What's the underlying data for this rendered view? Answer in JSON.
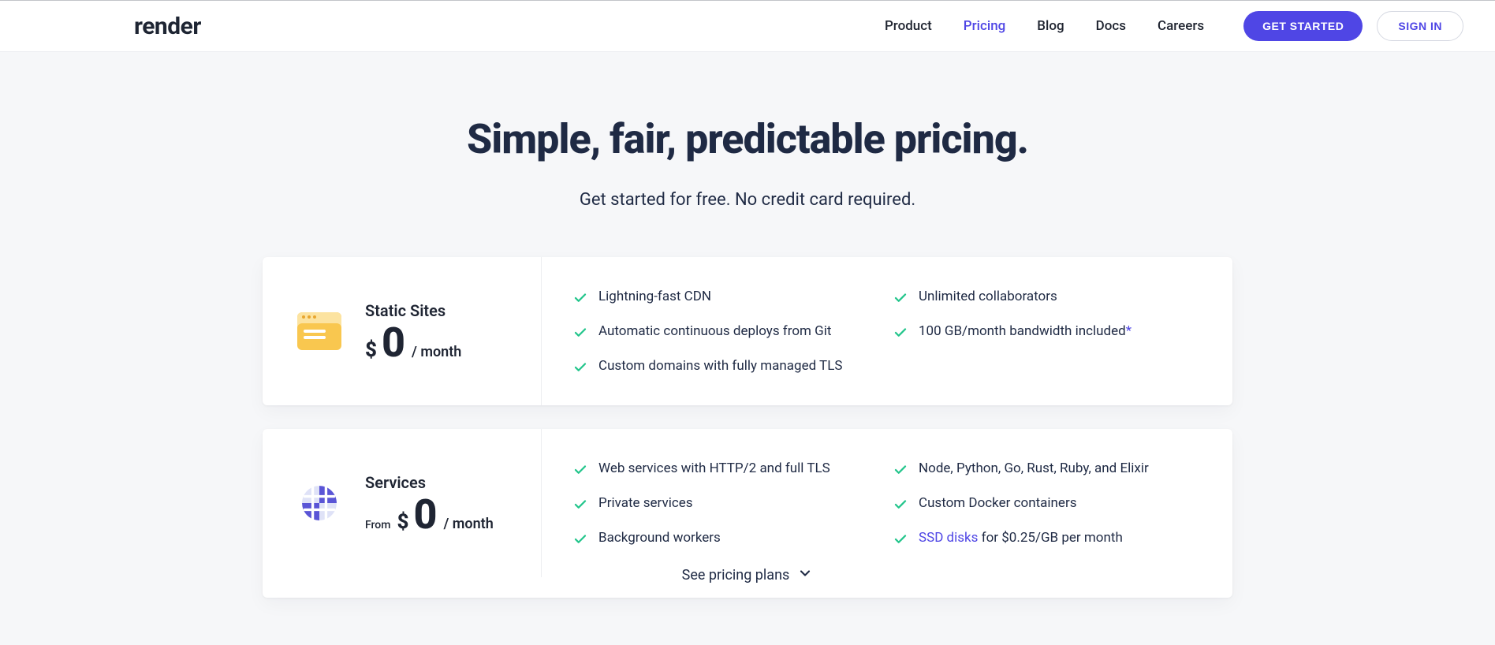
{
  "header": {
    "logo": "render",
    "nav": {
      "product": "Product",
      "pricing": "Pricing",
      "blog": "Blog",
      "docs": "Docs",
      "careers": "Careers"
    },
    "cta_primary": "GET STARTED",
    "cta_secondary": "SIGN IN"
  },
  "hero": {
    "title": "Simple, fair, predictable pricing.",
    "subtitle": "Get started for free. No credit card required."
  },
  "static_sites": {
    "title": "Static Sites",
    "currency": "$",
    "amount": "0",
    "unit": "/ month",
    "features": {
      "f1": "Lightning-fast CDN",
      "f2": "Unlimited collaborators",
      "f3": "Automatic continuous deploys from Git",
      "f4a": "100 GB/month bandwidth included",
      "f4b": "*",
      "f5": "Custom domains with fully managed TLS"
    }
  },
  "services": {
    "title": "Services",
    "from": "From",
    "currency": "$",
    "amount": "0",
    "unit": "/ month",
    "features": {
      "f1": "Web services with HTTP/2 and full TLS",
      "f2": "Node, Python, Go, Rust, Ruby, and Elixir",
      "f3": "Private services",
      "f4": "Custom Docker containers",
      "f5": "Background workers",
      "f6a": "SSD disks",
      "f6b": " for $0.25/GB per month"
    },
    "expand": "See pricing plans"
  }
}
